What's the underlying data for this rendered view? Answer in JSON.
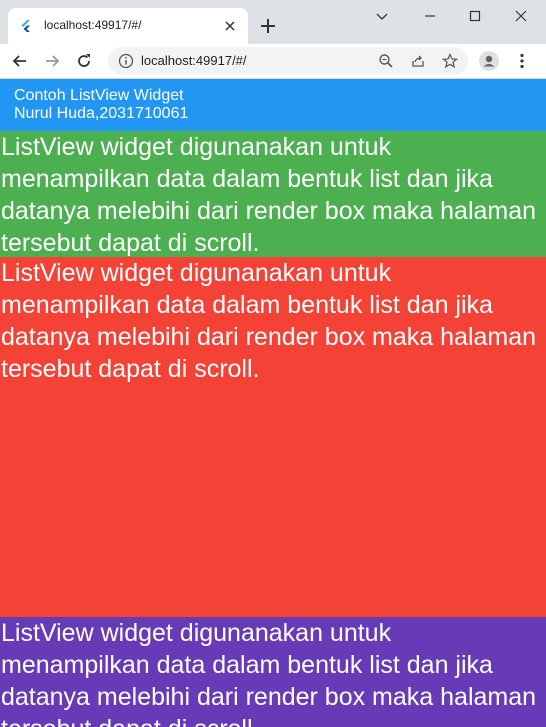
{
  "browser": {
    "tab_title": "localhost:49917/#/",
    "url": "localhost:49917/#/"
  },
  "app": {
    "title_line1": "Contoh ListView Widget",
    "title_line2": "Nurul Huda,2031710061",
    "appbar_color": "#2196f3"
  },
  "list": {
    "items": [
      {
        "text": "ListView widget digunanakan untuk menampilkan data dalam bentuk list dan jika datanya melebihi dari render box maka halaman tersebut dapat di scroll.",
        "color": "#4caf50"
      },
      {
        "text": "ListView widget digunanakan untuk menampilkan data dalam bentuk list dan jika datanya melebihi dari render box maka halaman tersebut dapat di scroll.",
        "color": "#f44336"
      },
      {
        "text": "ListView widget digunanakan untuk menampilkan data dalam bentuk list dan jika datanya melebihi dari render box maka halaman tersebut dapat di scroll.",
        "color": "#673ab7"
      }
    ]
  }
}
